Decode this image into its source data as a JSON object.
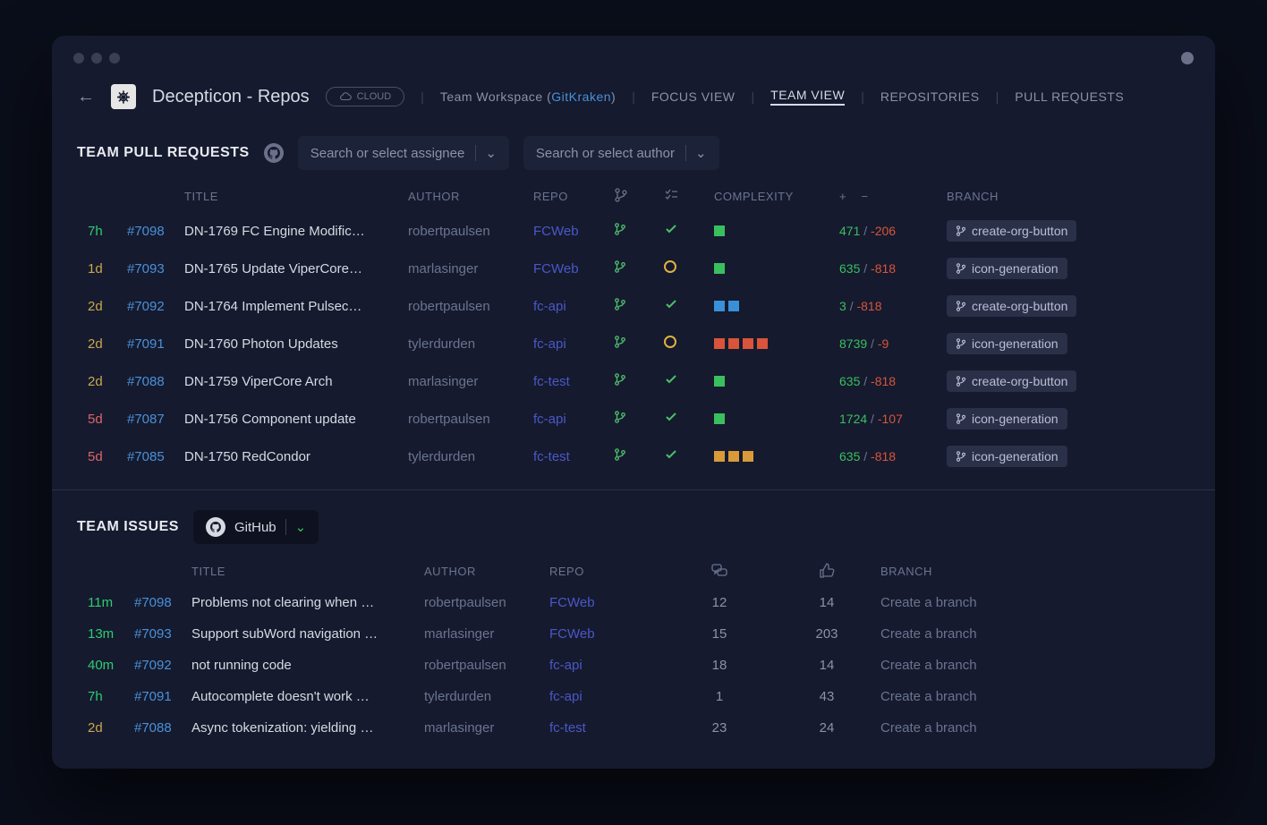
{
  "workspace": {
    "name": "Decepticon - Repos",
    "cloud_label": "CLOUD",
    "team_label_prefix": "Team Workspace (",
    "team_link": "GitKraken",
    "team_label_suffix": ")"
  },
  "nav": {
    "focus": "FOCUS VIEW",
    "team": "TEAM VIEW",
    "repos": "REPOSITORIES",
    "prs": "PULL REQUESTS"
  },
  "prsection": {
    "title": "TEAM PULL REQUESTS",
    "assignee_placeholder": "Search or select assignee",
    "author_placeholder": "Search or select author",
    "headers": {
      "title": "TITLE",
      "author": "AUTHOR",
      "repo": "REPO",
      "complexity": "COMPLEXITY",
      "plus": "+",
      "minus": "−",
      "branch": "BRANCH"
    },
    "rows": [
      {
        "age": "7h",
        "ageclass": "age7h",
        "num": "#7098",
        "title": "DN-1769 FC Engine Modific…",
        "author": "robertpaulsen",
        "repo": "FCWeb",
        "status": "check",
        "cx": [
          "g"
        ],
        "plus": "471",
        "minus": "-206",
        "branch": "create-org-button"
      },
      {
        "age": "1d",
        "ageclass": "age1d",
        "num": "#7093",
        "title": "DN-1765 Update ViperCore…",
        "author": "marlasinger",
        "repo": "FCWeb",
        "status": "circle",
        "cx": [
          "g"
        ],
        "plus": "635",
        "minus": "-818",
        "branch": "icon-generation"
      },
      {
        "age": "2d",
        "ageclass": "age2d",
        "num": "#7092",
        "title": "DN-1764 Implement Pulsec…",
        "author": "robertpaulsen",
        "repo": "fc-api",
        "status": "check",
        "cx": [
          "b",
          "b"
        ],
        "plus": "3",
        "minus": "-818",
        "branch": "create-org-button"
      },
      {
        "age": "2d",
        "ageclass": "age2d",
        "num": "#7091",
        "title": "DN-1760 Photon Updates",
        "author": "tylerdurden",
        "repo": "fc-api",
        "status": "circle",
        "cx": [
          "r",
          "r",
          "r",
          "r"
        ],
        "plus": "8739",
        "minus": "-9",
        "branch": "icon-generation"
      },
      {
        "age": "2d",
        "ageclass": "age2d",
        "num": "#7088",
        "title": "DN-1759 ViperCore Arch",
        "author": "marlasinger",
        "repo": "fc-test",
        "status": "check",
        "cx": [
          "g"
        ],
        "plus": "635",
        "minus": "-818",
        "branch": "create-org-button"
      },
      {
        "age": "5d",
        "ageclass": "age5d",
        "num": "#7087",
        "title": "DN-1756 Component update",
        "author": "robertpaulsen",
        "repo": "fc-api",
        "status": "check",
        "cx": [
          "g"
        ],
        "plus": "1724",
        "minus": "-107",
        "branch": "icon-generation"
      },
      {
        "age": "5d",
        "ageclass": "age5d",
        "num": "#7085",
        "title": "DN-1750 RedCondor",
        "author": "tylerdurden",
        "repo": "fc-test",
        "status": "check",
        "cx": [
          "o",
          "o",
          "o"
        ],
        "plus": "635",
        "minus": "-818",
        "branch": "icon-generation"
      }
    ]
  },
  "issuesection": {
    "title": "TEAM ISSUES",
    "provider": "GitHub",
    "headers": {
      "title": "TITLE",
      "author": "AUTHOR",
      "repo": "REPO",
      "branch": "BRANCH"
    },
    "rows": [
      {
        "age": "11m",
        "ageclass": "age11m",
        "num": "#7098",
        "title": "Problems not clearing when …",
        "author": "robertpaulsen",
        "repo": "FCWeb",
        "comments": "12",
        "thumbs": "14",
        "branch": "Create a branch"
      },
      {
        "age": "13m",
        "ageclass": "age13m",
        "num": "#7093",
        "title": "Support subWord navigation …",
        "author": "marlasinger",
        "repo": "FCWeb",
        "comments": "15",
        "thumbs": "203",
        "branch": "Create a branch"
      },
      {
        "age": "40m",
        "ageclass": "age40m",
        "num": "#7092",
        "title": "not running code",
        "author": "robertpaulsen",
        "repo": "fc-api",
        "comments": "18",
        "thumbs": "14",
        "branch": "Create a branch"
      },
      {
        "age": "7h",
        "ageclass": "age7h",
        "num": "#7091",
        "title": "Autocomplete doesn't work …",
        "author": "tylerdurden",
        "repo": "fc-api",
        "comments": "1",
        "thumbs": "43",
        "branch": "Create a branch"
      },
      {
        "age": "2d",
        "ageclass": "age2d",
        "num": "#7088",
        "title": "Async tokenization: yielding …",
        "author": "marlasinger",
        "repo": "fc-test",
        "comments": "23",
        "thumbs": "24",
        "branch": "Create a branch"
      }
    ]
  }
}
